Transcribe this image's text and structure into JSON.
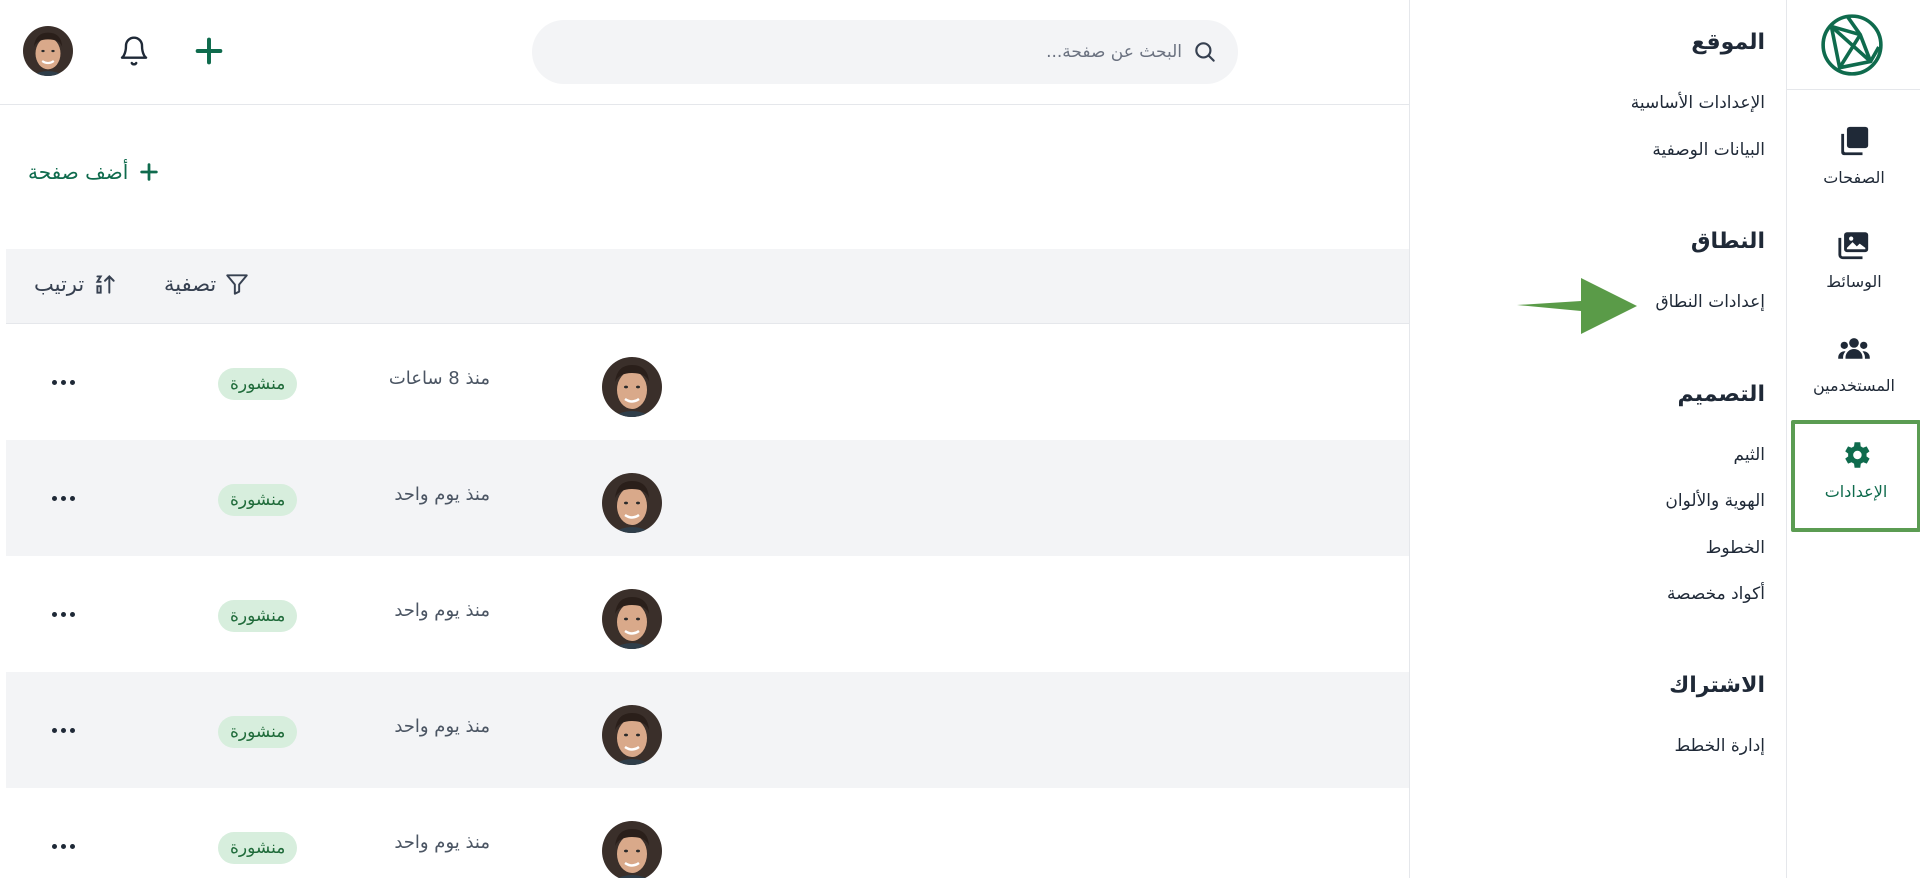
{
  "colors": {
    "accent": "#0f6b4d",
    "active_border": "#5b9c52",
    "badge_bg": "#d7eedd",
    "arrow": "#5a9b48"
  },
  "rail": {
    "logo_icon": "globe-logo-icon",
    "items": [
      {
        "label": "الصفحات",
        "icon": "pages-icon"
      },
      {
        "label": "الوسائط",
        "icon": "media-icon"
      },
      {
        "label": "المستخدمين",
        "icon": "users-icon"
      },
      {
        "label": "الإعدادات",
        "icon": "gear-icon",
        "active": true
      }
    ]
  },
  "menu": {
    "sections": [
      {
        "title": "الموقع",
        "links": [
          "الإعدادات الأساسية",
          "البيانات الوصفية"
        ]
      },
      {
        "title": "النطاق",
        "links": [
          "إعدادات النطاق"
        ]
      },
      {
        "title": "التصميم",
        "links": [
          "الثيم",
          "الهوية والألوان",
          "الخطوط",
          "أكواد مخصصة"
        ]
      },
      {
        "title": "الاشتراك",
        "links": [
          "إدارة الخطط"
        ]
      }
    ]
  },
  "topbar": {
    "search_placeholder": "البحث عن صفحة...",
    "icons": [
      "search-icon",
      "add-icon",
      "bell-icon",
      "user-avatar"
    ]
  },
  "main": {
    "add_page_label": "أضف صفحة",
    "filter_label": "تصفية",
    "sort_label": "ترتيب"
  },
  "rows": [
    {
      "time": "منذ 8 ساعات",
      "status": "منشورة"
    },
    {
      "time": "منذ يوم واحد",
      "status": "منشورة"
    },
    {
      "time": "منذ يوم واحد",
      "status": "منشورة"
    },
    {
      "time": "منذ يوم واحد",
      "status": "منشورة"
    },
    {
      "time": "منذ يوم واحد",
      "status": "منشورة"
    }
  ]
}
